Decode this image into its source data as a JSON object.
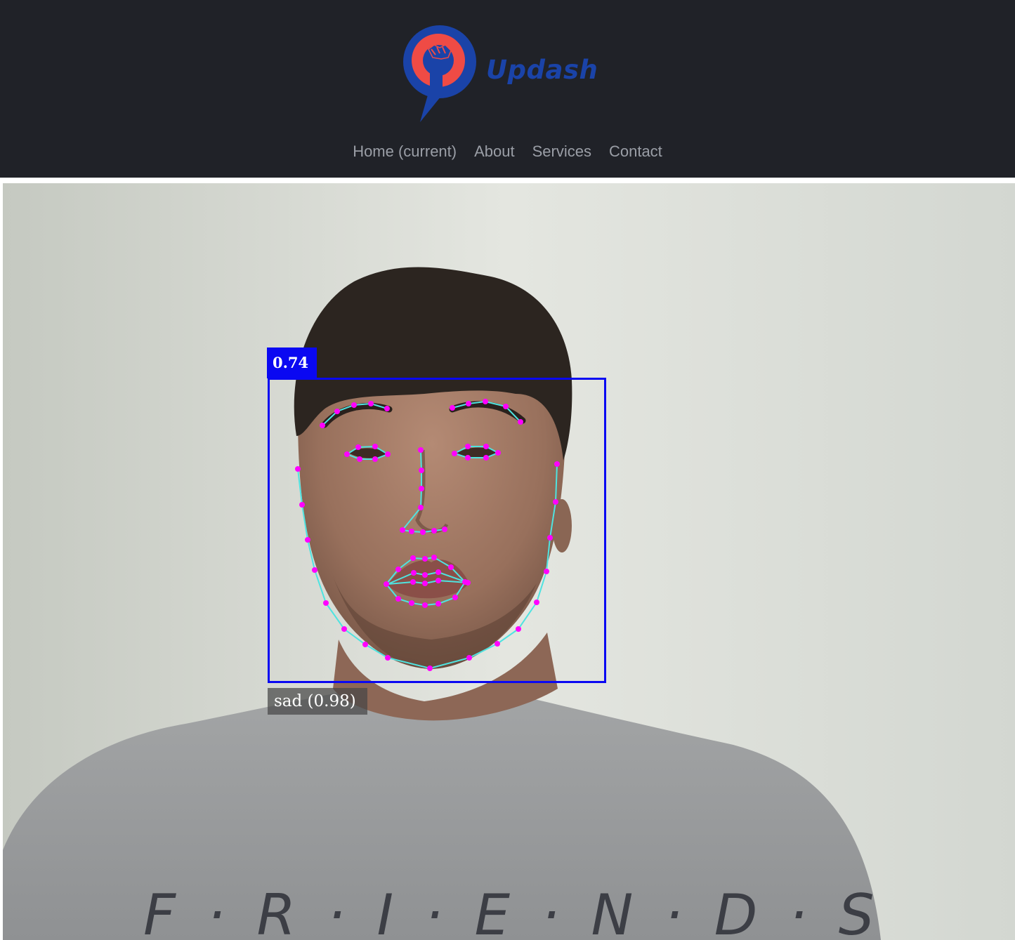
{
  "brand": {
    "name": "Updash",
    "logo_icon": "fist-in-speech-bubble-icon",
    "colors": {
      "bubble": "#1a43a8",
      "circle": "#ef4b45"
    }
  },
  "nav": {
    "items": [
      {
        "label": "Home (current)"
      },
      {
        "label": "About"
      },
      {
        "label": "Services"
      },
      {
        "label": "Contact"
      }
    ]
  },
  "detection": {
    "score": "0.74",
    "expression": "sad (0.98)",
    "colors": {
      "box": "#0a08f2",
      "landmark_point": "#ff00ff",
      "landmark_line": "#4fe3e0"
    }
  },
  "video": {
    "shirt_text": "F·R·I·E·N·D·S"
  }
}
